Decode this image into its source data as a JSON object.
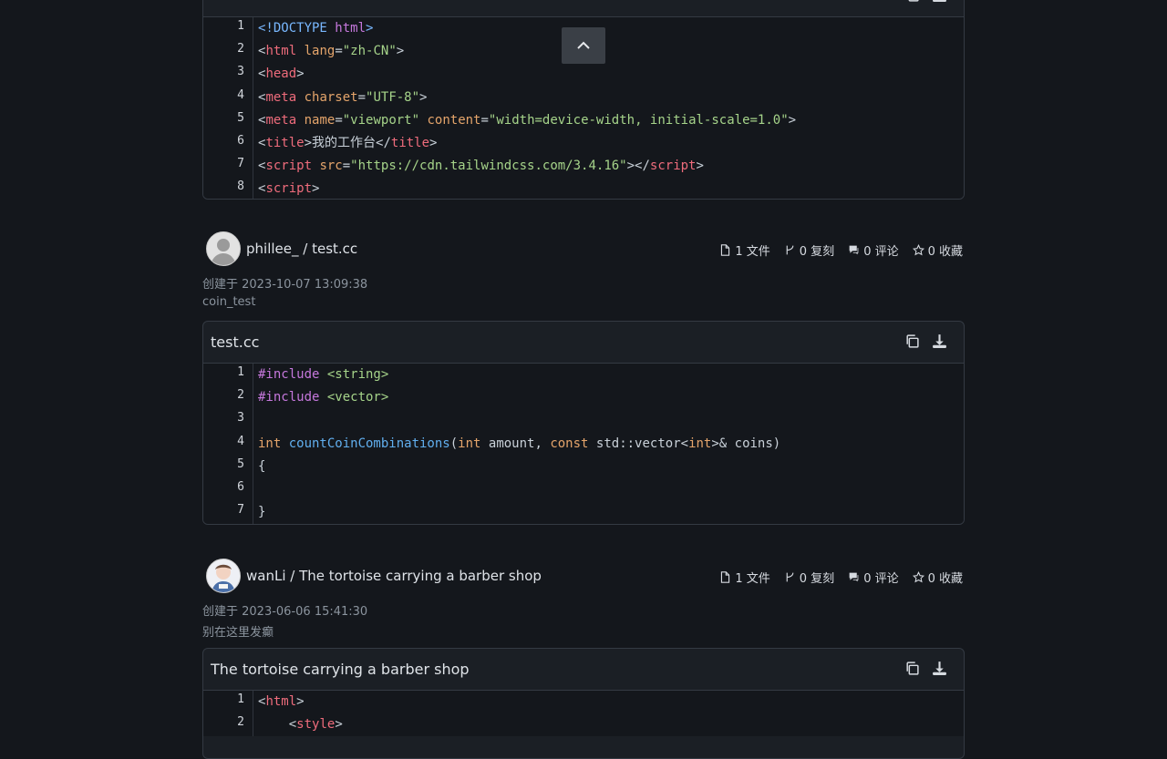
{
  "card0": {
    "title": "",
    "lines": [
      {
        "n": "1",
        "tokens": [
          {
            "t": "<!DOCTYPE ",
            "c": "doc"
          },
          {
            "t": "html",
            "c": "inc"
          },
          {
            "t": ">",
            "c": "doc"
          }
        ]
      },
      {
        "n": "2",
        "tokens": [
          {
            "t": "<",
            "c": "plain"
          },
          {
            "t": "html",
            "c": "tag"
          },
          {
            "t": " lang",
            "c": "attr"
          },
          {
            "t": "=",
            "c": "plain"
          },
          {
            "t": "\"zh-CN\"",
            "c": "str"
          },
          {
            "t": ">",
            "c": "plain"
          }
        ]
      },
      {
        "n": "3",
        "tokens": [
          {
            "t": "<",
            "c": "plain"
          },
          {
            "t": "head",
            "c": "tag"
          },
          {
            "t": ">",
            "c": "plain"
          }
        ]
      },
      {
        "n": "4",
        "tokens": [
          {
            "t": "<",
            "c": "plain"
          },
          {
            "t": "meta",
            "c": "tag"
          },
          {
            "t": " charset",
            "c": "attr"
          },
          {
            "t": "=",
            "c": "plain"
          },
          {
            "t": "\"UTF-8\"",
            "c": "str"
          },
          {
            "t": ">",
            "c": "plain"
          }
        ]
      },
      {
        "n": "5",
        "tokens": [
          {
            "t": "<",
            "c": "plain"
          },
          {
            "t": "meta",
            "c": "tag"
          },
          {
            "t": " name",
            "c": "attr"
          },
          {
            "t": "=",
            "c": "plain"
          },
          {
            "t": "\"viewport\"",
            "c": "str"
          },
          {
            "t": " content",
            "c": "attr"
          },
          {
            "t": "=",
            "c": "plain"
          },
          {
            "t": "\"width=device-width, initial-scale=1.0\"",
            "c": "str"
          },
          {
            "t": ">",
            "c": "plain"
          }
        ]
      },
      {
        "n": "6",
        "tokens": [
          {
            "t": "<",
            "c": "plain"
          },
          {
            "t": "title",
            "c": "tag"
          },
          {
            "t": ">我的工作台</",
            "c": "plain"
          },
          {
            "t": "title",
            "c": "tag"
          },
          {
            "t": ">",
            "c": "plain"
          }
        ]
      },
      {
        "n": "7",
        "tokens": [
          {
            "t": "<",
            "c": "plain"
          },
          {
            "t": "script",
            "c": "tag"
          },
          {
            "t": " src",
            "c": "attr"
          },
          {
            "t": "=",
            "c": "plain"
          },
          {
            "t": "\"https://cdn.tailwindcss.com/3.4.16\"",
            "c": "str"
          },
          {
            "t": "></",
            "c": "plain"
          },
          {
            "t": "script",
            "c": "tag"
          },
          {
            "t": ">",
            "c": "plain"
          }
        ]
      },
      {
        "n": "8",
        "tokens": [
          {
            "t": "<",
            "c": "plain"
          },
          {
            "t": "script",
            "c": "tag"
          },
          {
            "t": ">",
            "c": "plain"
          }
        ]
      }
    ]
  },
  "gist1": {
    "owner_and_name": "phillee_ / test.cc",
    "stats": {
      "files": "1 文件",
      "forks": "0 复刻",
      "comments": "0 评论",
      "stars": "0 收藏"
    },
    "created": "创建于 2023-10-07 13:09:38",
    "description": "coin_test",
    "file_title": "test.cc",
    "lines": [
      {
        "n": "1",
        "tokens": [
          {
            "t": "#include ",
            "c": "inc"
          },
          {
            "t": "<string>",
            "c": "str"
          }
        ]
      },
      {
        "n": "2",
        "tokens": [
          {
            "t": "#include ",
            "c": "inc"
          },
          {
            "t": "<vector>",
            "c": "str"
          }
        ]
      },
      {
        "n": "3",
        "tokens": []
      },
      {
        "n": "4",
        "tokens": [
          {
            "t": "int ",
            "c": "kw"
          },
          {
            "t": "countCoinCombinations",
            "c": "fn"
          },
          {
            "t": "(",
            "c": "plain"
          },
          {
            "t": "int",
            "c": "kw"
          },
          {
            "t": " amount, ",
            "c": "plain"
          },
          {
            "t": "const",
            "c": "kw"
          },
          {
            "t": " std::vector<",
            "c": "plain"
          },
          {
            "t": "int",
            "c": "kw"
          },
          {
            "t": ">& coins)",
            "c": "plain"
          }
        ]
      },
      {
        "n": "5",
        "tokens": [
          {
            "t": "{",
            "c": "plain"
          }
        ]
      },
      {
        "n": "6",
        "tokens": []
      },
      {
        "n": "7",
        "tokens": [
          {
            "t": "}",
            "c": "plain"
          }
        ]
      }
    ]
  },
  "gist2": {
    "owner_and_name": "wanLi / The tortoise carrying a barber shop",
    "stats": {
      "files": "1 文件",
      "forks": "0 复刻",
      "comments": "0 评论",
      "stars": "0 收藏"
    },
    "created": "创建于 2023-06-06 15:41:30",
    "description": "别在这里发癫",
    "file_title": "The tortoise carrying a barber shop",
    "lines": [
      {
        "n": "1",
        "tokens": [
          {
            "t": "<",
            "c": "plain"
          },
          {
            "t": "html",
            "c": "tag"
          },
          {
            "t": ">",
            "c": "plain"
          }
        ]
      },
      {
        "n": "2",
        "tokens": [
          {
            "t": "    <",
            "c": "plain"
          },
          {
            "t": "style",
            "c": "tag"
          },
          {
            "t": ">",
            "c": "plain"
          }
        ]
      }
    ]
  },
  "icons": {
    "copy": "copy-icon",
    "download": "download-icon",
    "file": "file-icon",
    "fork": "fork-icon",
    "comment": "comment-icon",
    "star": "star-icon",
    "scroll_top": "chevron-up-icon"
  }
}
